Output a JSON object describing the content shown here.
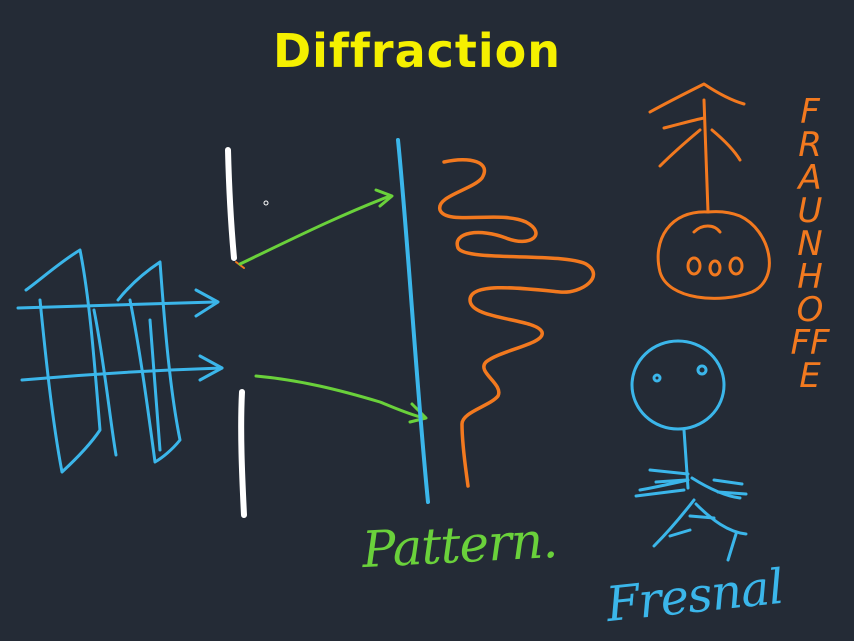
{
  "title": "Diffraction",
  "labels": {
    "pattern": "Pattern.",
    "fresnel": "Fresnal",
    "fraunhofer": "FRAUNHOFFE"
  },
  "colors": {
    "background": "#242b36",
    "title": "#f5f000",
    "wave": "#3bb6ea",
    "slit": "#ffffff",
    "ray": "#6ad13b",
    "pattern": "#f2791f",
    "screen": "#3bb6ea"
  }
}
